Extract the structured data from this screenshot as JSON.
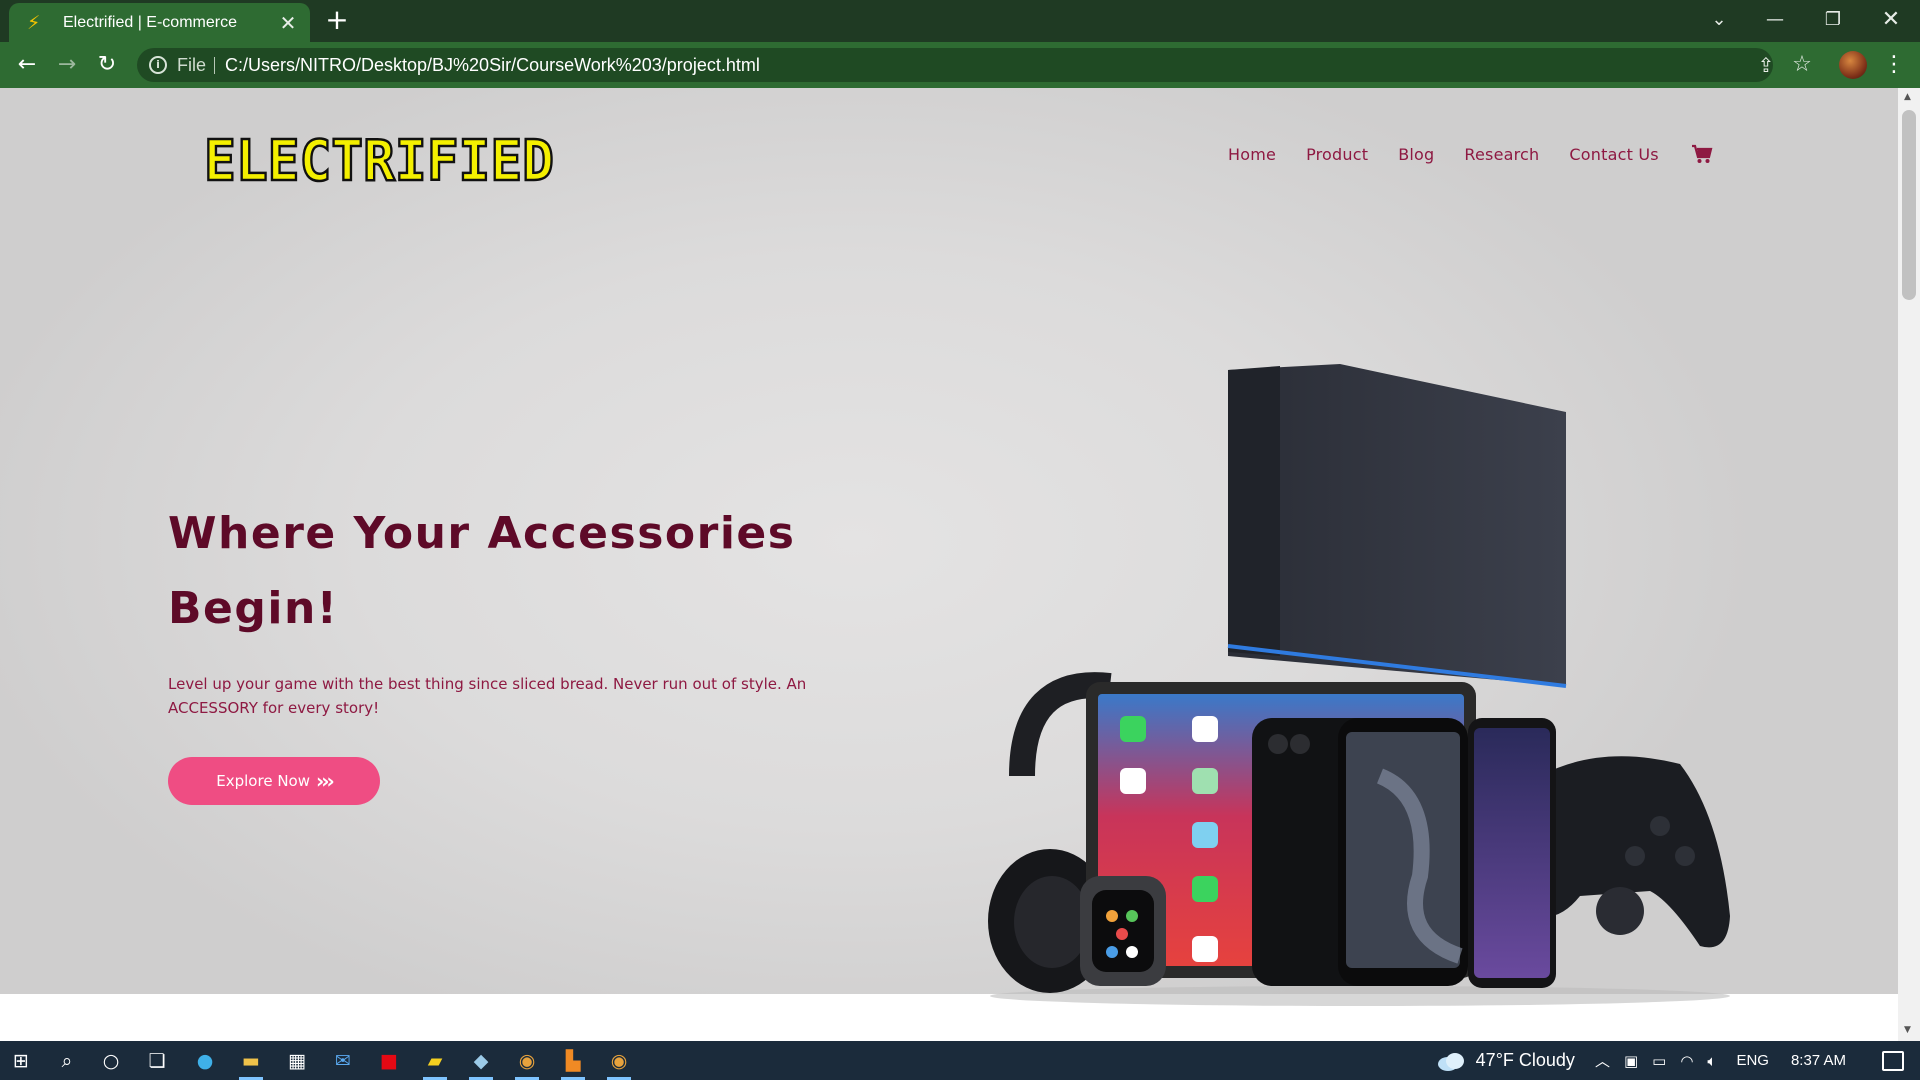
{
  "browser": {
    "tab": {
      "title": "Electrified | E-commerce",
      "favicon": "lightning-icon"
    },
    "new_tab_symbol": "+",
    "address": {
      "scheme_label": "File",
      "url": "C:/Users/NITRO/Desktop/BJ%20Sir/CourseWork%203/project.html"
    }
  },
  "site": {
    "logo_text": "ELECTRIFIED",
    "colors": {
      "accent": "#8e1942",
      "heading": "#5e0a28",
      "button": "#ef4d83",
      "logo": "#f4f000"
    },
    "nav": [
      {
        "label": "Home"
      },
      {
        "label": "Product"
      },
      {
        "label": "Blog"
      },
      {
        "label": "Research"
      },
      {
        "label": "Contact Us"
      }
    ],
    "cart_icon": "cart-icon",
    "hero": {
      "title": "Where Your Accessories Begin!",
      "text": "Level up your game with the best thing since sliced bread. Never run out of style. An ACCESSORY for every story!",
      "button_label": "Explore Now",
      "button_arrows": "›››"
    }
  },
  "taskbar": {
    "weather": {
      "temp": "47°F",
      "condition": "Cloudy"
    },
    "language": "ENG",
    "time": "8:37 AM"
  }
}
